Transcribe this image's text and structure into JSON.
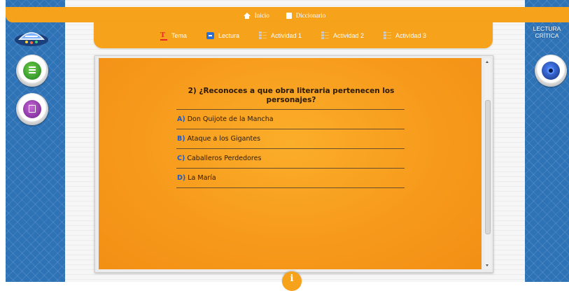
{
  "top_nav": {
    "items": [
      {
        "label": "Inicio",
        "icon": "home-icon"
      },
      {
        "label": "Diccionario",
        "icon": "dictionary-icon"
      }
    ]
  },
  "tabs": [
    {
      "label": "Tema",
      "icon": "tema-icon"
    },
    {
      "label": "Lectura",
      "icon": "lectura-icon"
    },
    {
      "label": "Actividad 1",
      "icon": "activity-list-icon"
    },
    {
      "label": "Actividad 2",
      "icon": "activity-list-icon"
    },
    {
      "label": "Actividad 3",
      "icon": "activity-list-icon"
    }
  ],
  "question": {
    "title": "2) ¿Reconoces a que obra literaria pertenecen los personajes?",
    "options": [
      {
        "letter": "A)",
        "text": "Don Quijote de la Mancha"
      },
      {
        "letter": "B)",
        "text": "Ataque a los Gigantes"
      },
      {
        "letter": "C)",
        "text": "Caballeros Perdedores"
      },
      {
        "letter": "D)",
        "text": "La María"
      }
    ]
  },
  "right_panel": {
    "label_line1": "LECTURA",
    "label_line2": "CRÍTICA"
  },
  "info_button": {
    "label": "i"
  },
  "colors": {
    "accent_orange": "#f6a21b",
    "side_blue": "#2f73b7",
    "option_letter_blue": "#1d5bc9"
  }
}
